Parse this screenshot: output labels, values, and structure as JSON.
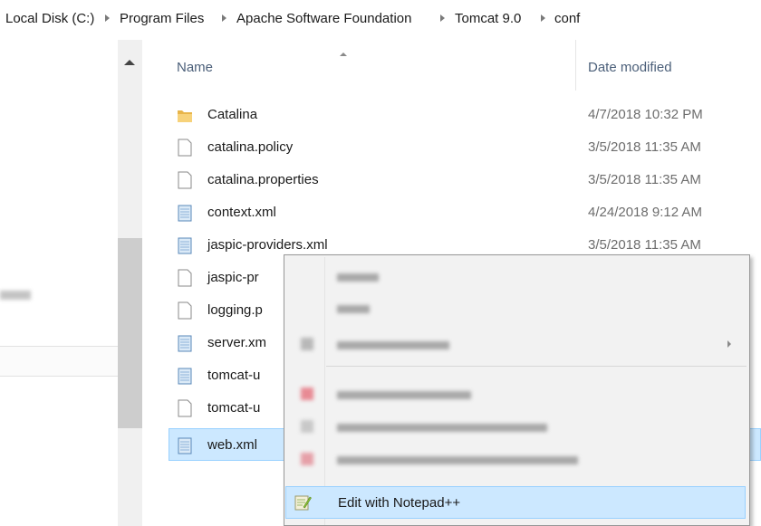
{
  "breadcrumb": {
    "items": [
      "Local Disk (C:)",
      "Program Files",
      "Apache Software Foundation",
      "Tomcat 9.0",
      "conf"
    ]
  },
  "columns": {
    "name": "Name",
    "date_modified": "Date modified"
  },
  "files": [
    {
      "name": "Catalina",
      "date": "4/7/2018 10:32 PM",
      "icon": "folder-icon"
    },
    {
      "name": "catalina.policy",
      "date": "3/5/2018 11:35 AM",
      "icon": "file-icon"
    },
    {
      "name": "catalina.properties",
      "date": "3/5/2018 11:35 AM",
      "icon": "file-icon"
    },
    {
      "name": "context.xml",
      "date": "4/24/2018 9:12 AM",
      "icon": "xml-file-icon"
    },
    {
      "name": "jaspic-providers.xml",
      "date": "3/5/2018 11:35 AM",
      "icon": "xml-file-icon"
    },
    {
      "name": "jaspic-pr",
      "date": "",
      "icon": "file-icon"
    },
    {
      "name": "logging.p",
      "date": "",
      "icon": "file-icon"
    },
    {
      "name": "server.xm",
      "date": "",
      "icon": "xml-file-icon"
    },
    {
      "name": "tomcat-u",
      "date": "",
      "icon": "xml-file-icon"
    },
    {
      "name": "tomcat-u",
      "date": "",
      "icon": "file-icon"
    },
    {
      "name": "web.xml",
      "date": "",
      "icon": "xml-file-icon"
    }
  ],
  "context_menu": {
    "highlighted_item": {
      "label": "Edit with Notepad++",
      "icon": "notepad-plus-plus-icon"
    }
  },
  "colors": {
    "selection_bg": "#cce8ff",
    "selection_border": "#99d1ff",
    "header_text": "#4c607a",
    "folder": "#e8b54a"
  }
}
